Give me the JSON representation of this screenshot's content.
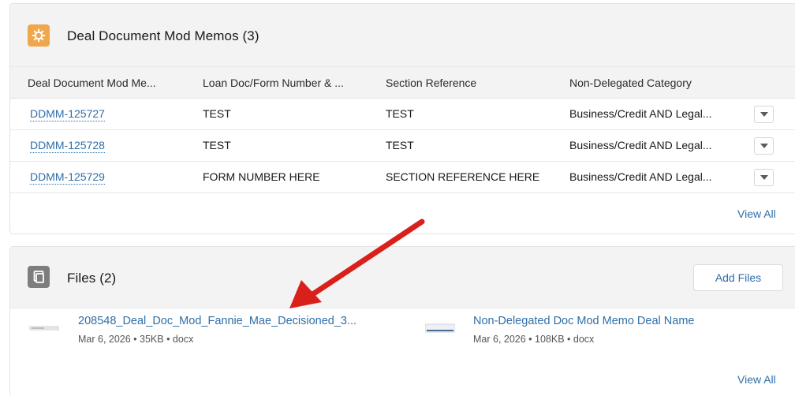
{
  "memos": {
    "title": "Deal Document Mod Memos (3)",
    "icon": "gear-icon",
    "accent": "#f0a64b",
    "columns": [
      "Deal Document Mod Me...",
      "Loan Doc/Form Number & ...",
      "Section Reference",
      "Non-Delegated Category"
    ],
    "rows": [
      {
        "id": "DDMM-125727",
        "form": "TEST",
        "section": "TEST",
        "category": "Business/Credit AND Legal..."
      },
      {
        "id": "DDMM-125728",
        "form": "TEST",
        "section": "TEST",
        "category": "Business/Credit AND Legal..."
      },
      {
        "id": "DDMM-125729",
        "form": "FORM NUMBER HERE",
        "section": "SECTION REFERENCE HERE",
        "category": "Business/Credit AND Legal..."
      }
    ],
    "view_all": "View All"
  },
  "files": {
    "title": "Files (2)",
    "icon": "files-icon",
    "add_button": "Add Files",
    "items": [
      {
        "name": "208548_Deal_Doc_Mod_Fannie_Mae_Decisioned_3...",
        "meta": "Mar 6, 2026 • 35KB • docx"
      },
      {
        "name": "Non-Delegated Doc Mod Memo Deal Name",
        "meta": "Mar 6, 2026 • 108KB • docx"
      }
    ],
    "view_all": "View All"
  },
  "colors": {
    "link": "#2f6ea8",
    "arrow": "#d9201b"
  }
}
